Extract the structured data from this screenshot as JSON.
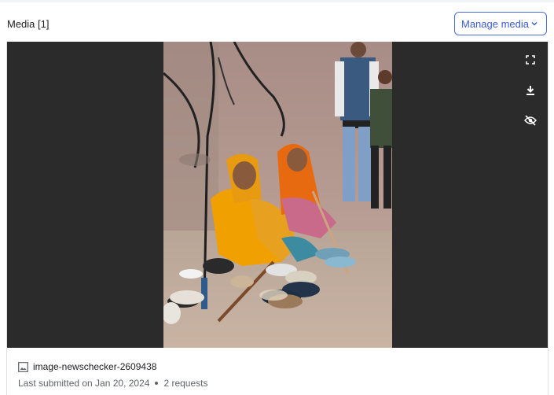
{
  "header": {
    "title": "Media [1]",
    "manage_label": "Manage media"
  },
  "viewer": {
    "controls": [
      "fullscreen-icon",
      "download-icon",
      "hide-icon"
    ]
  },
  "media_item": {
    "name": "image-newschecker-2609438",
    "submitted": "Last submitted on Jan 20, 2024",
    "requests": "2 requests"
  },
  "colors": {
    "accent": "#3a5ccc",
    "viewer_bg": "#2b2b2b"
  }
}
